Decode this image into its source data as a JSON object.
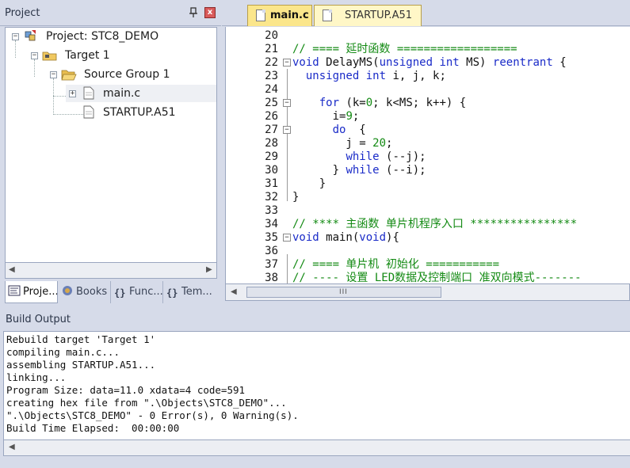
{
  "project_panel": {
    "title": "Project",
    "close_symbol": "x",
    "tree": {
      "project": "Project: STC8_DEMO",
      "target": "Target 1",
      "group": "Source Group 1",
      "files": [
        "main.c",
        "STARTUP.A51"
      ]
    },
    "tabs": [
      {
        "label": "Proje...",
        "icon": "project-icon"
      },
      {
        "label": "Books",
        "icon": "books-icon"
      },
      {
        "label": "Func...",
        "icon": "functions-icon"
      },
      {
        "label": "Tem...",
        "icon": "templates-icon"
      }
    ],
    "tab_icon_glyphs": {
      "functions": "{}",
      "templates": "{}"
    }
  },
  "editor": {
    "tabs": [
      {
        "label": "main.c",
        "active": true
      },
      {
        "label": "STARTUP.A51",
        "active": false
      }
    ],
    "lines": [
      {
        "n": "20",
        "code": ""
      },
      {
        "n": "21",
        "code": "// ==== 延时函数 =================="
      },
      {
        "n": "22",
        "code": "void DelayMS(unsigned int MS) reentrant {"
      },
      {
        "n": "23",
        "code": "  unsigned int i, j, k;"
      },
      {
        "n": "24",
        "code": ""
      },
      {
        "n": "25",
        "code": "    for (k=0; k<MS; k++) {"
      },
      {
        "n": "26",
        "code": "      i=9;"
      },
      {
        "n": "27",
        "code": "      do  {"
      },
      {
        "n": "28",
        "code": "        j = 20;"
      },
      {
        "n": "29",
        "code": "        while (--j);"
      },
      {
        "n": "30",
        "code": "      } while (--i);"
      },
      {
        "n": "31",
        "code": "    }"
      },
      {
        "n": "32",
        "code": "}"
      },
      {
        "n": "33",
        "code": ""
      },
      {
        "n": "34",
        "code": "// **** 主函数 单片机程序入口 ****************"
      },
      {
        "n": "35",
        "code": "void main(void){"
      },
      {
        "n": "36",
        "code": ""
      },
      {
        "n": "37",
        "code": "// ==== 单片机 初始化 ==========="
      },
      {
        "n": "38",
        "code": "// ---- 设置 LED数据及控制端口 准双向模式-------"
      }
    ],
    "scroll_grip": "III"
  },
  "build_output": {
    "title": "Build Output",
    "lines": [
      "Rebuild target 'Target 1'",
      "compiling main.c...",
      "assembling STARTUP.A51...",
      "linking...",
      "Program Size: data=11.0 xdata=4 code=591",
      "creating hex file from \".\\Objects\\STC8_DEMO\"...",
      "\".\\Objects\\STC8_DEMO\" - 0 Error(s), 0 Warning(s).",
      "Build Time Elapsed:  00:00:00"
    ]
  },
  "colors": {
    "keyword": "#1a2bc8",
    "comment": "#138a13",
    "active_tab": "#fbe68b",
    "inactive_tab": "#fff7c7",
    "chrome": "#d6dbe9"
  }
}
